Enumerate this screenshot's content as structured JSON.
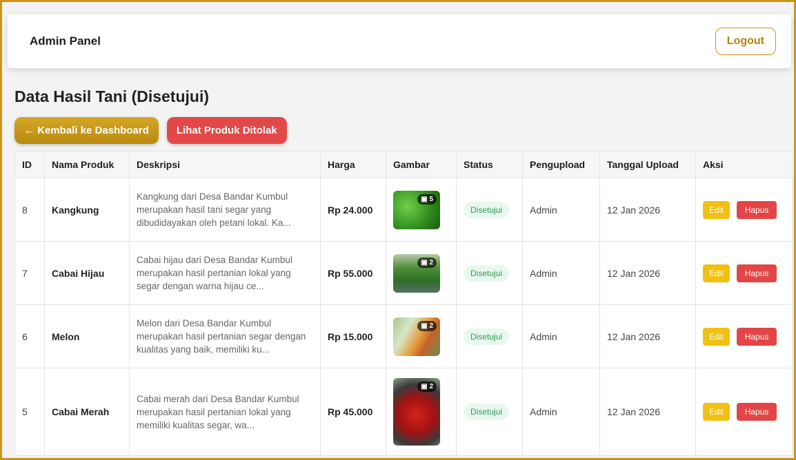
{
  "navbar": {
    "brand": "Admin Panel",
    "logout": "Logout"
  },
  "page": {
    "title": "Data Hasil Tani (Disetujui)",
    "back_button": "← Kembali ke Dashboard",
    "rejected_button": "Lihat Produk Ditolak"
  },
  "table": {
    "headers": [
      "ID",
      "Nama Produk",
      "Deskripsi",
      "Harga",
      "Gambar",
      "Status",
      "Pengupload",
      "Tanggal Upload",
      "Aksi"
    ],
    "rows": [
      {
        "id": "8",
        "name": "Kangkung",
        "desc1": "Kangkung dari Desa Bandar Kumbul",
        "desc2": "merupakan hasil tani segar yang",
        "desc3": "dibudidayakan oleh petani lokal. Ka...",
        "price": "Rp 24.000",
        "img_count": "5",
        "status": "Disetujui",
        "uploader": "Admin",
        "date": "12 Jan 2026",
        "edit": "Edit",
        "delete": "Hapus"
      },
      {
        "id": "7",
        "name": "Cabai Hijau",
        "desc1": "Cabai hijau dari Desa Bandar Kumbul",
        "desc2": "merupakan hasil pertanian lokal yang",
        "desc3": "segar dengan warna hijau ce...",
        "price": "Rp 55.000",
        "img_count": "2",
        "status": "Disetujui",
        "uploader": "Admin",
        "date": "12 Jan 2026",
        "edit": "Edit",
        "delete": "Hapus"
      },
      {
        "id": "6",
        "name": "Melon",
        "desc1": "Melon dari Desa Bandar Kumbul",
        "desc2": "merupakan hasil pertanian segar dengan",
        "desc3": "kualitas yang baik, memiliki ku...",
        "price": "Rp 15.000",
        "img_count": "2",
        "status": "Disetujui",
        "uploader": "Admin",
        "date": "12 Jan 2026",
        "edit": "Edit",
        "delete": "Hapus"
      },
      {
        "id": "5",
        "name": "Cabai Merah",
        "desc1": "Cabai merah dari Desa Bandar Kumbul",
        "desc2": "merupakan hasil pertanian lokal yang",
        "desc3": "memiliki kualitas segar, wa...",
        "price": "Rp 45.000",
        "img_count": "2",
        "status": "Disetujui",
        "uploader": "Admin",
        "date": "12 Jan 2026",
        "edit": "Edit",
        "delete": "Hapus"
      }
    ]
  },
  "icons": {
    "image_count": "image-icon"
  },
  "colors": {
    "accent": "#c9961a",
    "danger": "#e34848",
    "success": "#2c9a52",
    "edit": "#f2c010"
  }
}
